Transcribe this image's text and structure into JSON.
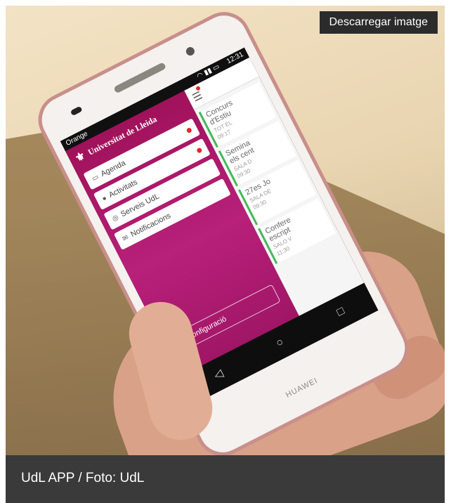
{
  "download_button": {
    "label": "Descarregar imatge"
  },
  "caption": "UdL APP / Foto: UdL",
  "phone": {
    "brand": "HUAWEI",
    "status": {
      "carrier": "Orange",
      "time": "12:31"
    },
    "app": {
      "header_title": "Universitat de Lleida",
      "menu_items": [
        {
          "label": "Agenda",
          "icon": "calendar-icon",
          "notified": true
        },
        {
          "label": "Activitats",
          "icon": "user-icon",
          "notified": true
        },
        {
          "label": "Serveis UdL",
          "icon": "services-icon",
          "notified": false
        },
        {
          "label": "Notificacions",
          "icon": "mail-icon",
          "notified": false
        }
      ],
      "config_label": "Configuració",
      "cards": [
        {
          "title": "Concurs\nd'Estiu",
          "location": "TOT EL",
          "time": "09:17"
        },
        {
          "title": "Semina\nels cent",
          "location": "SALA D",
          "time": "09:30"
        },
        {
          "title": "27es Jo",
          "location": "SALA DE",
          "time": "09:30"
        },
        {
          "title": "Confere\nescript",
          "location": "SALO V",
          "time": "11:30"
        }
      ]
    }
  },
  "colors": {
    "app_magenta": "#a0125a",
    "card_accent": "#45b85a",
    "caption_bg": "#3a3a3a"
  }
}
